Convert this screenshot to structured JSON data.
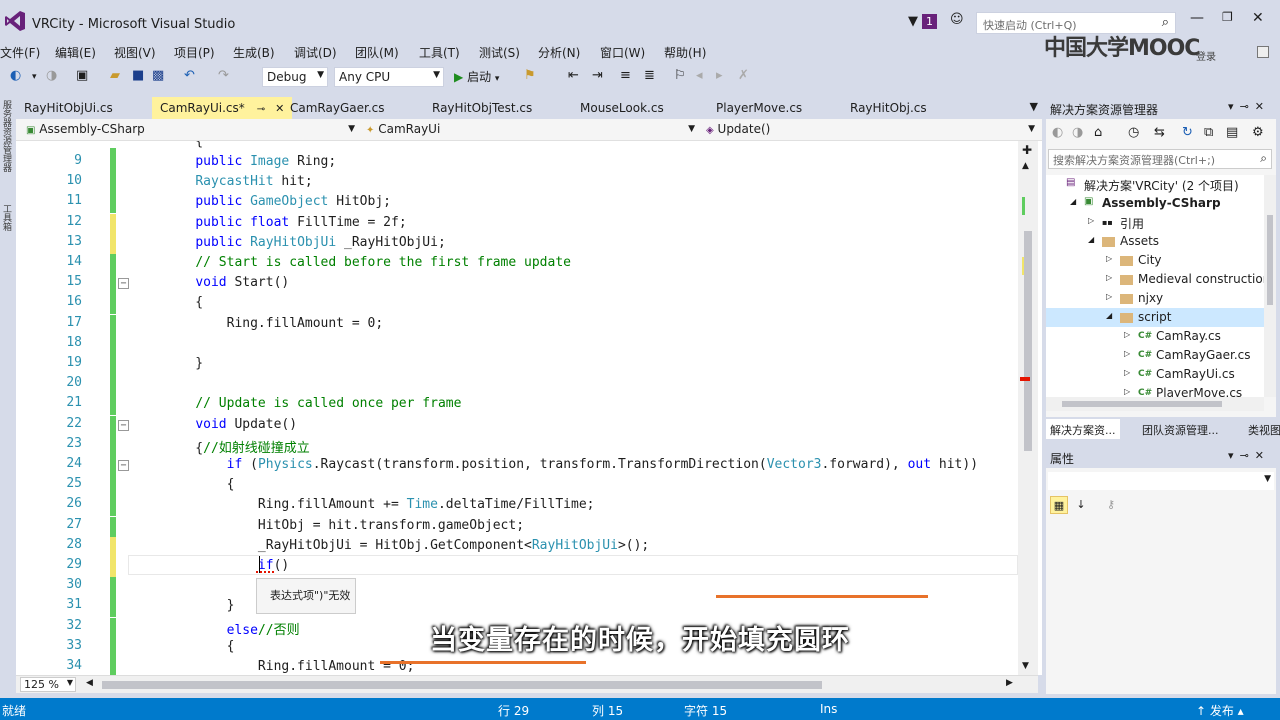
{
  "window": {
    "title": "VRCity - Microsoft Visual Studio",
    "notify_count": "1",
    "quick_launch_placeholder": "快速启动 (Ctrl+Q)",
    "watermark": "中国大学MOOC",
    "watermark_sub": "登录"
  },
  "menu": [
    "文件(F)",
    "编辑(E)",
    "视图(V)",
    "项目(P)",
    "生成(B)",
    "调试(D)",
    "团队(M)",
    "工具(T)",
    "测试(S)",
    "分析(N)",
    "窗口(W)",
    "帮助(H)"
  ],
  "toolbar": {
    "config": "Debug",
    "platform": "Any CPU",
    "start_label": "启动"
  },
  "left_strip": [
    "服务器资源管理器",
    "工具箱"
  ],
  "tabs": [
    {
      "label": "RayHitObjUi.cs",
      "active": false
    },
    {
      "label": "CamRayUi.cs*",
      "active": true
    },
    {
      "label": "CamRayGaer.cs",
      "active": false
    },
    {
      "label": "RayHitObjTest.cs",
      "active": false
    },
    {
      "label": "MouseLook.cs",
      "active": false
    },
    {
      "label": "PlayerMove.cs",
      "active": false
    },
    {
      "label": "RayHitObj.cs",
      "active": false
    }
  ],
  "nav": {
    "project": "Assembly-CSharp",
    "class": "CamRayUi",
    "member": "Update()"
  },
  "code_lines": [
    {
      "n": "9",
      "mark": "green",
      "fold": "",
      "parts": [
        [
          "    ",
          "tx"
        ],
        [
          "public ",
          "kw"
        ],
        [
          "Image ",
          "ty"
        ],
        [
          "Ring;",
          "tx"
        ]
      ]
    },
    {
      "n": "10",
      "mark": "green",
      "fold": "",
      "parts": [
        [
          "    ",
          "tx"
        ],
        [
          "RaycastHit ",
          "ty"
        ],
        [
          "hit;",
          "tx"
        ]
      ]
    },
    {
      "n": "11",
      "mark": "green",
      "fold": "",
      "parts": [
        [
          "    ",
          "tx"
        ],
        [
          "public ",
          "kw"
        ],
        [
          "GameObject ",
          "ty"
        ],
        [
          "HitObj;",
          "tx"
        ]
      ]
    },
    {
      "n": "12",
      "mark": "yellow",
      "fold": "",
      "parts": [
        [
          "    ",
          "tx"
        ],
        [
          "public ",
          "kw"
        ],
        [
          "float ",
          "kw"
        ],
        [
          "FillTime = 2f;",
          "tx"
        ]
      ]
    },
    {
      "n": "13",
      "mark": "yellow",
      "fold": "",
      "parts": [
        [
          "    ",
          "tx"
        ],
        [
          "public ",
          "kw"
        ],
        [
          "RayHitObjUi ",
          "ty"
        ],
        [
          "_RayHitObjUi;",
          "tx"
        ]
      ]
    },
    {
      "n": "14",
      "mark": "green",
      "fold": "",
      "parts": [
        [
          "    ",
          "tx"
        ],
        [
          "// Start is called before the first frame update",
          "cm"
        ]
      ]
    },
    {
      "n": "15",
      "mark": "green",
      "fold": "⊟",
      "parts": [
        [
          "    ",
          "tx"
        ],
        [
          "void ",
          "kw"
        ],
        [
          "Start()",
          "tx"
        ]
      ]
    },
    {
      "n": "16",
      "mark": "green",
      "fold": "",
      "parts": [
        [
          "    {",
          "tx"
        ]
      ]
    },
    {
      "n": "17",
      "mark": "green",
      "fold": "",
      "parts": [
        [
          "        Ring.fillAmount = 0;",
          "tx"
        ]
      ]
    },
    {
      "n": "18",
      "mark": "green",
      "fold": "",
      "parts": [
        [
          "",
          "tx"
        ]
      ]
    },
    {
      "n": "19",
      "mark": "green",
      "fold": "",
      "parts": [
        [
          "    }",
          "tx"
        ]
      ]
    },
    {
      "n": "20",
      "mark": "green",
      "fold": "",
      "parts": [
        [
          "",
          "tx"
        ]
      ]
    },
    {
      "n": "21",
      "mark": "green",
      "fold": "",
      "parts": [
        [
          "    ",
          "tx"
        ],
        [
          "// Update is called once per frame",
          "cm"
        ]
      ]
    },
    {
      "n": "22",
      "mark": "green",
      "fold": "⊟",
      "parts": [
        [
          "    ",
          "tx"
        ],
        [
          "void ",
          "kw"
        ],
        [
          "Update()",
          "tx"
        ]
      ]
    },
    {
      "n": "23",
      "mark": "green",
      "fold": "",
      "parts": [
        [
          "    {",
          "tx"
        ],
        [
          "//如射线碰撞成立",
          "cm"
        ]
      ]
    },
    {
      "n": "24",
      "mark": "green",
      "fold": "⊟",
      "parts": [
        [
          "        ",
          "tx"
        ],
        [
          "if ",
          "kw"
        ],
        [
          "(",
          "tx"
        ],
        [
          "Physics",
          "ty"
        ],
        [
          ".Raycast(transform.position, transform.TransformDirection(",
          "tx"
        ],
        [
          "Vector3",
          "ty"
        ],
        [
          ".forward), ",
          "tx"
        ],
        [
          "out ",
          "kw"
        ],
        [
          "hit))",
          "tx"
        ]
      ]
    },
    {
      "n": "25",
      "mark": "green",
      "fold": "",
      "parts": [
        [
          "        {",
          "tx"
        ]
      ]
    },
    {
      "n": "26",
      "mark": "green",
      "fold": "",
      "parts": [
        [
          "            Ring.fillAmount += ",
          "tx"
        ],
        [
          "Time",
          "ty"
        ],
        [
          ".deltaTime/FillTime;",
          "tx"
        ]
      ]
    },
    {
      "n": "27",
      "mark": "green",
      "fold": "",
      "parts": [
        [
          "            HitObj = hit.transform.gameObject;",
          "tx"
        ]
      ]
    },
    {
      "n": "28",
      "mark": "yellow",
      "fold": "",
      "parts": [
        [
          "            _RayHitObjUi = HitObj.GetComponent<",
          "tx"
        ],
        [
          "RayHitObjUi",
          "ty"
        ],
        [
          ">();",
          "tx"
        ]
      ]
    },
    {
      "n": "29",
      "mark": "yellow",
      "fold": "",
      "parts": [
        [
          "            ",
          "tx"
        ],
        [
          "if",
          "kw"
        ],
        [
          "()",
          "tx"
        ]
      ]
    },
    {
      "n": "30",
      "mark": "green",
      "fold": "",
      "parts": [
        [
          "",
          "tx"
        ]
      ]
    },
    {
      "n": "31",
      "mark": "green",
      "fold": "",
      "parts": [
        [
          "        }",
          "tx"
        ]
      ]
    },
    {
      "n": "32",
      "mark": "green",
      "fold": "",
      "parts": [
        [
          "        ",
          "tx"
        ],
        [
          "else",
          "kw"
        ],
        [
          "//否则",
          "cm"
        ]
      ]
    },
    {
      "n": "33",
      "mark": "green",
      "fold": "",
      "parts": [
        [
          "        {",
          "tx"
        ]
      ]
    },
    {
      "n": "34",
      "mark": "green",
      "fold": "",
      "parts": [
        [
          "            Ring.fillAmount = 0;",
          "tx"
        ]
      ]
    }
  ],
  "partial_top_line": "    {",
  "tooltip": "表达式项\")\"无效",
  "zoom": "125 %",
  "solution": {
    "title": "解决方案资源管理器",
    "search_placeholder": "搜索解决方案资源管理器(Ctrl+;)",
    "tree": [
      {
        "label": "解决方案'VRCity' (2 个项目)",
        "indent": 0,
        "arrow": "",
        "icon": "sln",
        "bold": false
      },
      {
        "label": "Assembly-CSharp",
        "indent": 1,
        "arrow": "◢",
        "icon": "proj",
        "bold": true
      },
      {
        "label": "引用",
        "indent": 2,
        "arrow": "▷",
        "icon": "ref",
        "bold": false
      },
      {
        "label": "Assets",
        "indent": 2,
        "arrow": "◢",
        "icon": "folder",
        "bold": false
      },
      {
        "label": "City",
        "indent": 3,
        "arrow": "▷",
        "icon": "folder",
        "bold": false
      },
      {
        "label": "Medieval construction",
        "indent": 3,
        "arrow": "▷",
        "icon": "folder",
        "bold": false
      },
      {
        "label": "njxy",
        "indent": 3,
        "arrow": "▷",
        "icon": "folder",
        "bold": false
      },
      {
        "label": "script",
        "indent": 3,
        "arrow": "◢",
        "icon": "folder",
        "bold": false,
        "selected": true
      },
      {
        "label": "CamRay.cs",
        "indent": 4,
        "arrow": "▷",
        "icon": "cs",
        "bold": false
      },
      {
        "label": "CamRayGaer.cs",
        "indent": 4,
        "arrow": "▷",
        "icon": "cs",
        "bold": false
      },
      {
        "label": "CamRayUi.cs",
        "indent": 4,
        "arrow": "▷",
        "icon": "cs",
        "bold": false
      },
      {
        "label": "PlayerMove.cs",
        "indent": 4,
        "arrow": "▷",
        "icon": "cs",
        "bold": false
      }
    ],
    "bottom_tabs": [
      "解决方案资...",
      "团队资源管理...",
      "类视图"
    ]
  },
  "properties": {
    "title": "属性"
  },
  "status": {
    "left": "就绪",
    "line": "行 29",
    "col": "列 15",
    "char": "字符 15",
    "mode": "Ins",
    "publish": "↑ 发布 ▴"
  },
  "subtitle": "当变量存在的时候，开始填充圆环",
  "colors": {
    "accent": "#007acc",
    "active_tab": "#fff29d",
    "keyword": "#0000ff",
    "type": "#2b91af",
    "comment": "#008000"
  }
}
